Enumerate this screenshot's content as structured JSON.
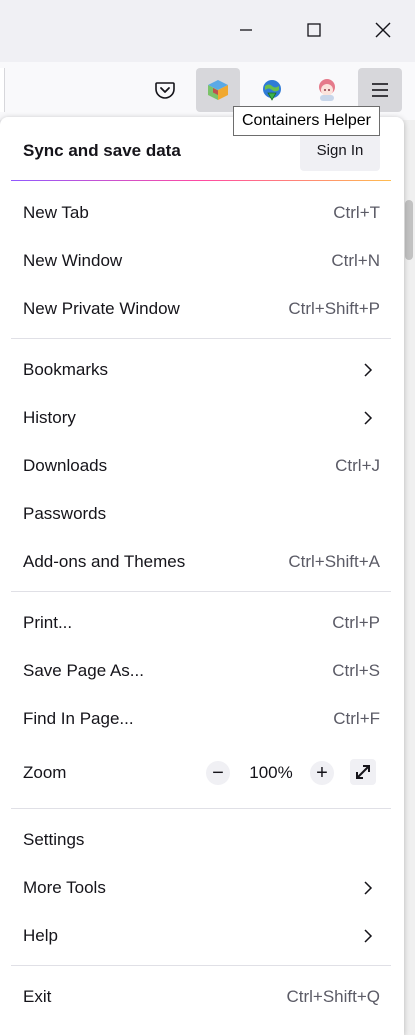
{
  "tooltip": "Containers Helper",
  "sync": {
    "title": "Sync and save data",
    "sign_in": "Sign In"
  },
  "groups": [
    [
      {
        "label": "New Tab",
        "shortcut": "Ctrl+T"
      },
      {
        "label": "New Window",
        "shortcut": "Ctrl+N"
      },
      {
        "label": "New Private Window",
        "shortcut": "Ctrl+Shift+P"
      }
    ],
    [
      {
        "label": "Bookmarks",
        "submenu": true
      },
      {
        "label": "History",
        "submenu": true
      },
      {
        "label": "Downloads",
        "shortcut": "Ctrl+J"
      },
      {
        "label": "Passwords"
      },
      {
        "label": "Add-ons and Themes",
        "shortcut": "Ctrl+Shift+A"
      }
    ],
    [
      {
        "label": "Print...",
        "shortcut": "Ctrl+P"
      },
      {
        "label": "Save Page As...",
        "shortcut": "Ctrl+S"
      },
      {
        "label": "Find In Page...",
        "shortcut": "Ctrl+F"
      }
    ]
  ],
  "zoom": {
    "label": "Zoom",
    "minus": "−",
    "value": "100%",
    "plus": "+"
  },
  "groups2": [
    [
      {
        "label": "Settings"
      },
      {
        "label": "More Tools",
        "submenu": true
      },
      {
        "label": "Help",
        "submenu": true
      }
    ],
    [
      {
        "label": "Exit",
        "shortcut": "Ctrl+Shift+Q"
      }
    ]
  ],
  "colors": {
    "accent_gradient": [
      "#9059ff",
      "#ff4aa2",
      "#ffbd4f"
    ],
    "active_button": "#d7d7db"
  }
}
